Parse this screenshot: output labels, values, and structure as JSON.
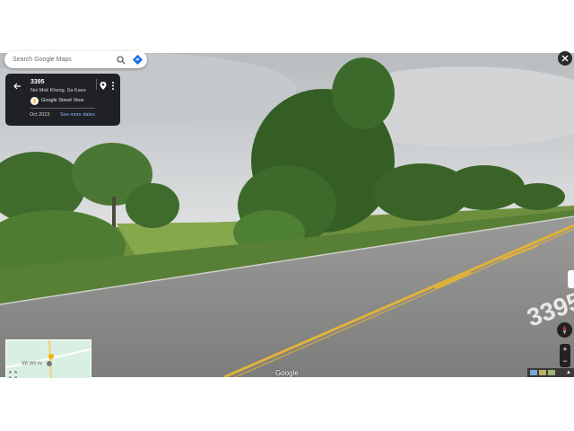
{
  "search": {
    "placeholder": "Search Google Maps"
  },
  "icons": {
    "search": "search-icon",
    "directions": "directions-icon",
    "back": "back-arrow-icon",
    "pin": "location-pin-icon",
    "more": "more-vert-icon",
    "close": "close-icon",
    "compass": "compass-icon",
    "expand": "expand-icon",
    "pegman": "pegman-icon"
  },
  "info_card": {
    "title": "3395",
    "subtitle": "Noi Mok Kheng, Sa Kaeo",
    "source_label": "Google Street View",
    "date": "Oct 2023",
    "more_dates_label": "See more dates"
  },
  "minimap": {
    "place_label": "ปลายราบ"
  },
  "viewer": {
    "brand": "Google",
    "road_marking": "3395"
  },
  "zoom": {
    "in_label": "+",
    "out_label": "−"
  },
  "colors": {
    "card_bg": "#202124",
    "link": "#8ab4f8",
    "directions": "#1a73e8",
    "road": "#8a8a8a",
    "center_line": "#e0b23a",
    "sky": "#c9ccce",
    "foliage": "#3f6b2c"
  }
}
